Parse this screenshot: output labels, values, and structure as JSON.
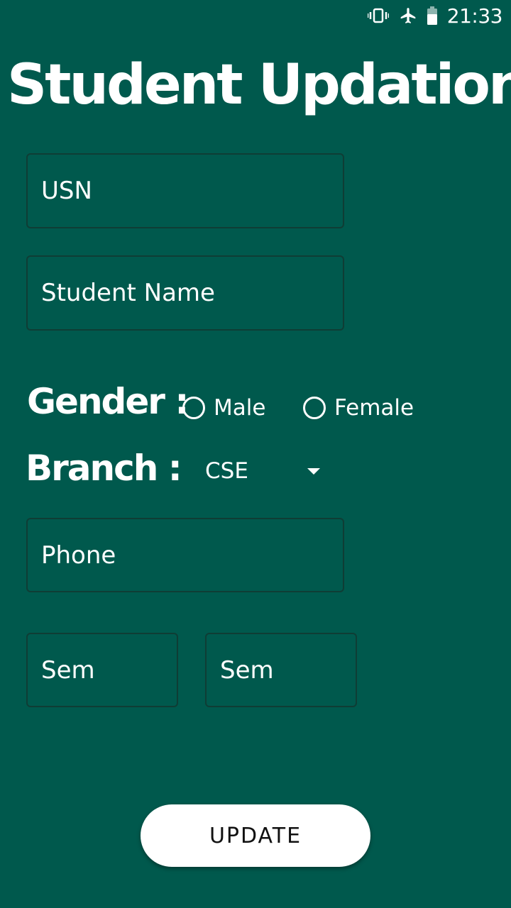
{
  "status_bar": {
    "time": "21:33",
    "icons": [
      "vibrate-icon",
      "airplane-mode-icon",
      "battery-icon"
    ]
  },
  "form": {
    "title": "Student Updation",
    "usn_placeholder": "USN",
    "name_placeholder": "Student Name",
    "gender": {
      "label": "Gender :",
      "options": [
        "Male",
        "Female"
      ]
    },
    "branch": {
      "label": "Branch :",
      "selected": "CSE"
    },
    "phone_placeholder": "Phone",
    "sem_placeholder_1": "Sem",
    "sem_placeholder_2": "Sem",
    "submit_label": "UPDATE"
  },
  "colors": {
    "background": "#00594d",
    "field_border": "#0f3d35",
    "button_bg": "#ffffff",
    "text": "#ffffff"
  }
}
